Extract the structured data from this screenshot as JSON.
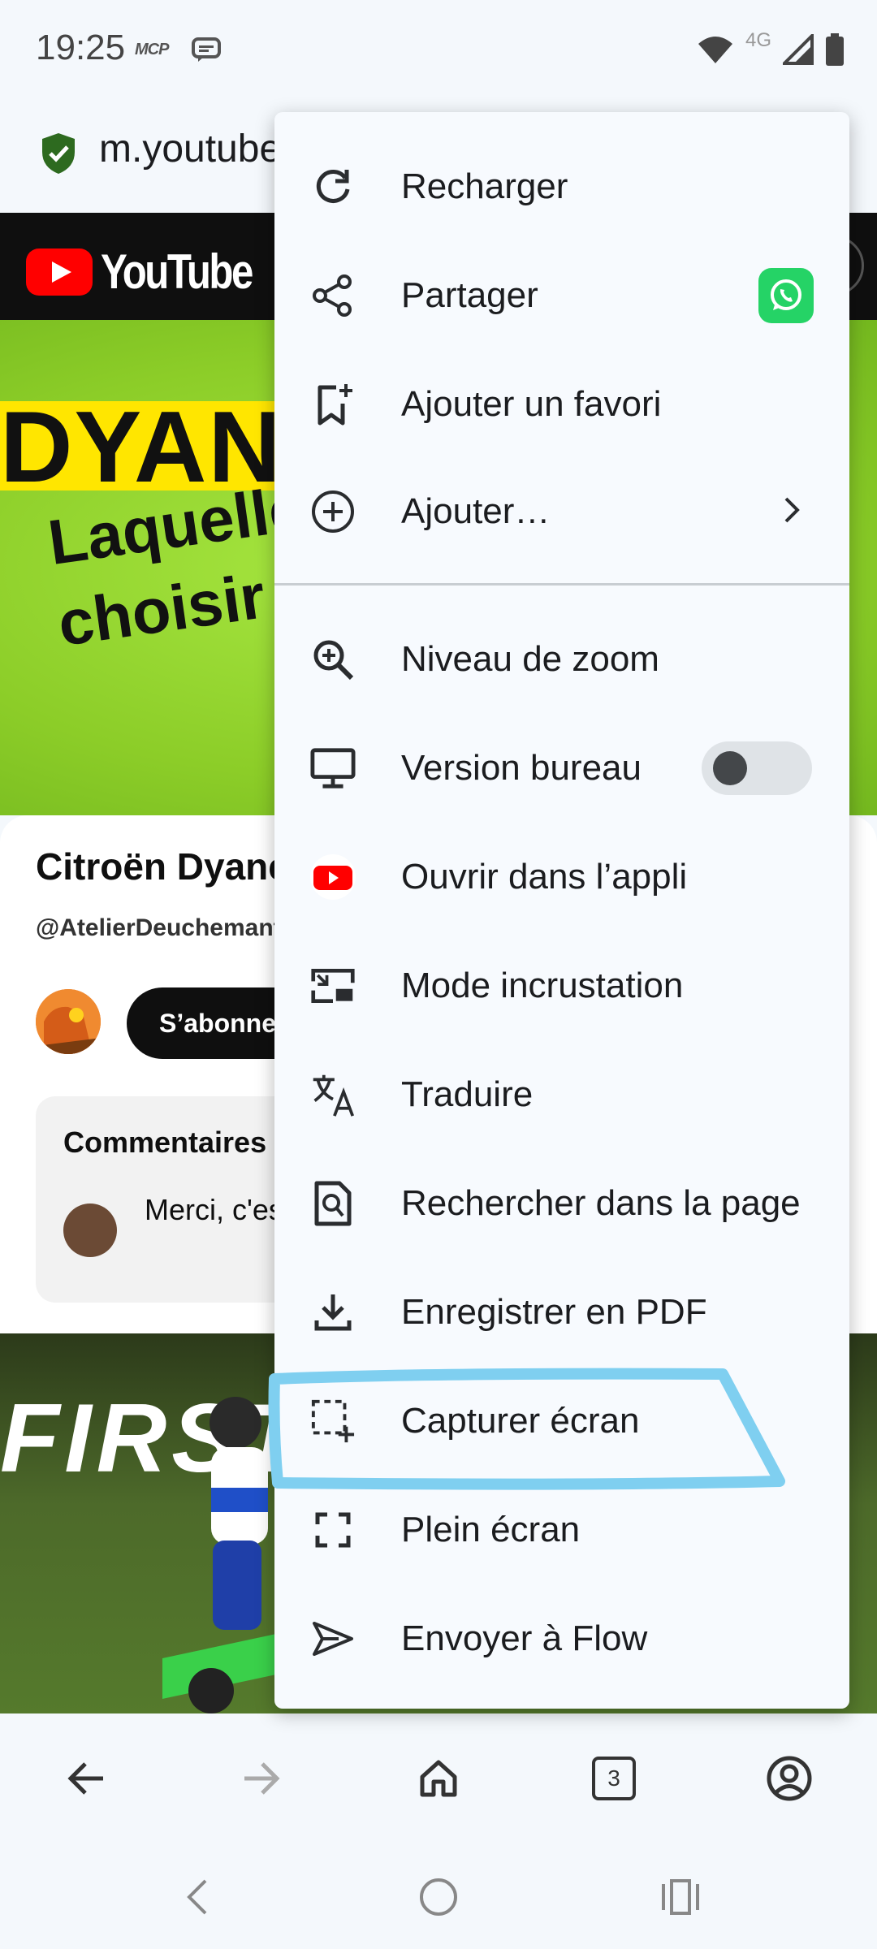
{
  "status_bar": {
    "time": "19:25",
    "carrier_badge": "MCP",
    "network": "4G"
  },
  "url_bar": {
    "url": "m.youtube.com"
  },
  "youtube": {
    "logo_text": "YouTube",
    "thumbnail": {
      "line_big": "DYANE",
      "line1": "Laquelle",
      "line2": "choisir ?"
    },
    "video_title": "Citroën Dyane",
    "channel_handle": "@AtelierDeuchemantier",
    "subscribe_label": "S’abonner",
    "comments": {
      "title": "Commentaires",
      "first_comment": "Merci, c'est nombreuses"
    },
    "thumbnail2_text": "FIRST"
  },
  "menu": {
    "items": [
      {
        "label": "Recharger",
        "icon": "reload-icon"
      },
      {
        "label": "Partager",
        "icon": "share-icon"
      },
      {
        "label": "Ajouter un favori",
        "icon": "bookmark-add-icon"
      },
      {
        "label": "Ajouter…",
        "icon": "add-circle-icon"
      },
      {
        "label": "Niveau de zoom",
        "icon": "zoom-in-icon"
      },
      {
        "label": "Version bureau",
        "icon": "desktop-icon",
        "toggle_on": false
      },
      {
        "label": "Ouvrir dans l’appli",
        "icon": "youtube-app-icon"
      },
      {
        "label": "Mode incrustation",
        "icon": "picture-in-picture-icon"
      },
      {
        "label": "Traduire",
        "icon": "translate-icon"
      },
      {
        "label": "Rechercher dans la page",
        "icon": "find-in-page-icon"
      },
      {
        "label": "Enregistrer en PDF",
        "icon": "download-icon"
      },
      {
        "label": "Capturer écran",
        "icon": "screenshot-icon"
      },
      {
        "label": "Plein écran",
        "icon": "fullscreen-icon"
      },
      {
        "label": "Envoyer à Flow",
        "icon": "send-icon"
      }
    ]
  },
  "toolbar": {
    "tabs_count": "3"
  },
  "colors": {
    "youtube_red": "#ff0000",
    "whatsapp_green": "#25d366",
    "highlight_stroke": "#7fcff0",
    "thumbnail_green": "#8ed22e"
  }
}
